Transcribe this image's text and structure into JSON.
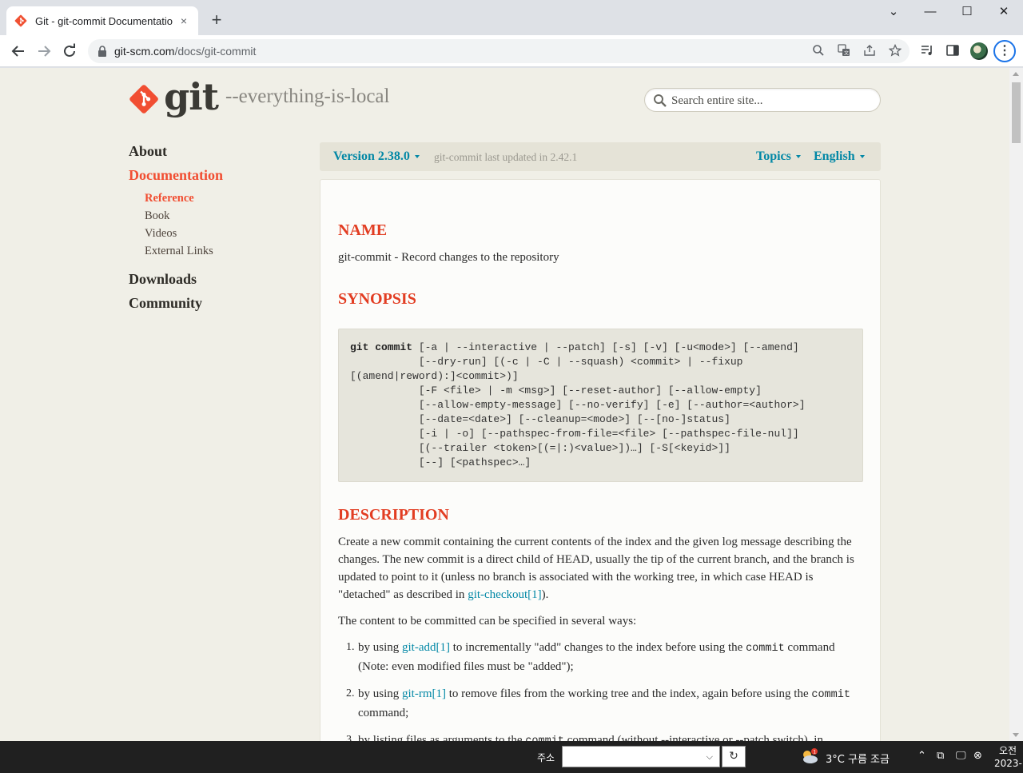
{
  "browser": {
    "tab_title": "Git - git-commit Documentation",
    "tab_close": "×",
    "new_tab": "+",
    "url_host": "git-scm.com",
    "url_path": "/docs/git-commit",
    "window_controls": {
      "minimize": "—",
      "maximize": "☐",
      "close": "✕",
      "tabsearch": "⌄"
    }
  },
  "site": {
    "logo_text": "git",
    "tagline": "--everything-is-local",
    "search_placeholder": "Search entire site..."
  },
  "sidenav": {
    "about": "About",
    "documentation": "Documentation",
    "reference": "Reference",
    "book": "Book",
    "videos": "Videos",
    "external_links": "External Links",
    "downloads": "Downloads",
    "community": "Community"
  },
  "versionbar": {
    "version": "Version 2.38.0",
    "updated": "git-commit last updated in 2.42.1",
    "topics": "Topics",
    "language": "English"
  },
  "content": {
    "name_heading": "NAME",
    "name_text": "git-commit - Record changes to the repository",
    "synopsis_heading": "SYNOPSIS",
    "synopsis_cmd": "git commit",
    "synopsis_lines": [
      " [-a | --interactive | --patch] [-s] [-v] [-u<mode>] [--amend]",
      "           [--dry-run] [(-c | -C | --squash) <commit> | --fixup",
      "[(amend|reword):]<commit>)]",
      "           [-F <file> | -m <msg>] [--reset-author] [--allow-empty]",
      "           [--allow-empty-message] [--no-verify] [-e] [--author=<author>]",
      "           [--date=<date>] [--cleanup=<mode>] [--[no-]status]",
      "           [-i | -o] [--pathspec-from-file=<file> [--pathspec-file-nul]]",
      "           [(--trailer <token>[(=|:)<value>])…] [-S[<keyid>]]",
      "           [--] [<pathspec>…]"
    ],
    "description_heading": "DESCRIPTION",
    "desc_p1_a": "Create a new commit containing the current contents of the index and the given log message describing the changes. The new commit is a direct child of HEAD, usually the tip of the current branch, and the branch is updated to point to it (unless no branch is associated with the working tree, in which case HEAD is \"detached\" as described in ",
    "desc_p1_link": "git-checkout[1]",
    "desc_p1_b": ").",
    "desc_p2": "The content to be committed can be specified in several ways:",
    "list": [
      {
        "num": "1.",
        "pre": "by using ",
        "link": "git-add[1]",
        "post": " to incrementally \"add\" changes to the index before using the ",
        "code": "commit",
        "post2": " command (Note: even modified files must be \"added\");"
      },
      {
        "num": "2.",
        "pre": "by using ",
        "link": "git-rm[1]",
        "post": " to remove files from the working tree and the index, again before using the ",
        "code": "commit",
        "post2": " command;"
      },
      {
        "num": "3.",
        "pre": "by listing files as arguments to the ",
        "code": "commit",
        "post": " command (without --interactive or --patch switch), in"
      }
    ]
  },
  "taskbar": {
    "address_label": "주소",
    "refresh": "↻",
    "weather": "3°C  구름 조금",
    "clock_time": "오전",
    "clock_date": "2023-"
  }
}
